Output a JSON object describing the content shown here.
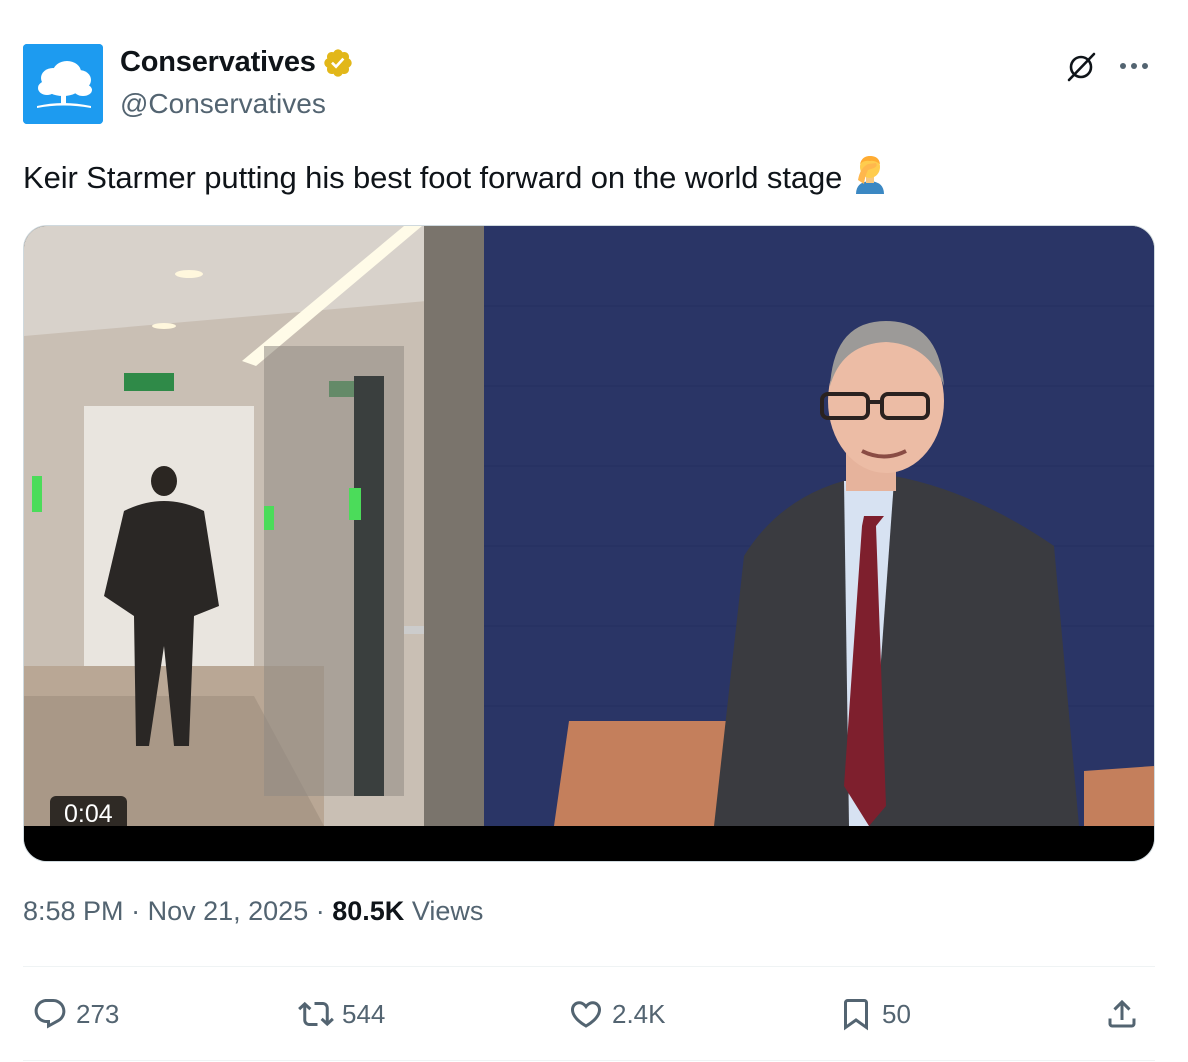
{
  "author": {
    "display_name": "Conservatives",
    "handle": "@Conservatives",
    "verified_badge": "gold-check-icon",
    "avatar": "conservative-tree-logo"
  },
  "header_icons": [
    "grok-icon",
    "more-icon"
  ],
  "tweet": {
    "text": "Keir Starmer putting his best foot forward on the world stage",
    "emoji": "🤦‍♂️"
  },
  "media": {
    "type": "video",
    "duration": "0:04"
  },
  "meta": {
    "time": "8:58 PM",
    "separator": "·",
    "date": "Nov 21, 2025",
    "views_count": "80.5K",
    "views_label": "Views"
  },
  "actions": {
    "replies": "273",
    "reposts": "544",
    "likes": "2.4K",
    "bookmarks": "50"
  },
  "colors": {
    "brand_blue": "#1d9bf0",
    "text_primary": "#0f1419",
    "text_secondary": "#536471",
    "verified_gold": "#e2b719"
  }
}
